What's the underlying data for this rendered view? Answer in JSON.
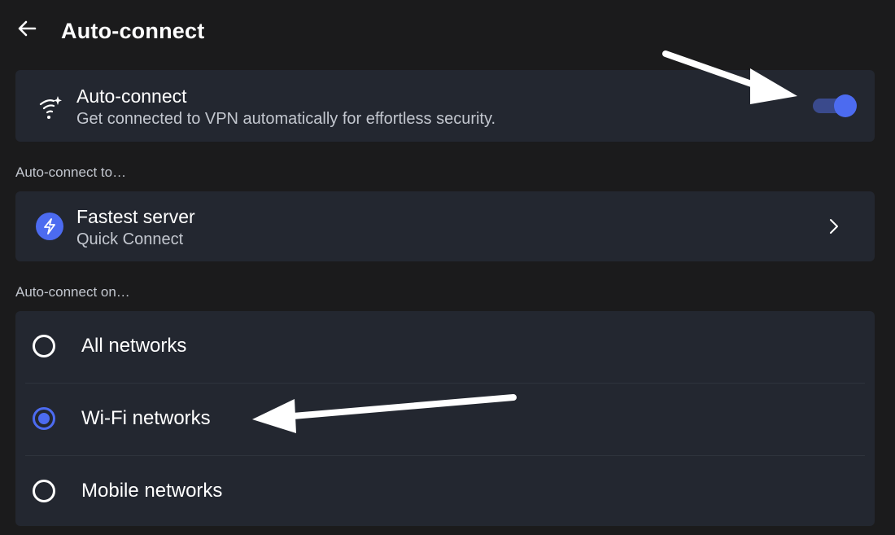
{
  "header": {
    "back_icon": "arrow-left-icon",
    "title": "Auto-connect"
  },
  "auto_connect": {
    "icon": "wifi-sparkle-icon",
    "title": "Auto-connect",
    "subtitle": "Get connected to VPN automatically for effortless security.",
    "enabled": true
  },
  "auto_connect_to": {
    "section_label": "Auto-connect to…",
    "icon": "bolt-icon",
    "title": "Fastest server",
    "subtitle": "Quick Connect",
    "chevron_icon": "chevron-right-icon"
  },
  "auto_connect_on": {
    "section_label": "Auto-connect on…",
    "options": [
      {
        "label": "All networks",
        "selected": false
      },
      {
        "label": "Wi-Fi networks",
        "selected": true
      },
      {
        "label": "Mobile networks",
        "selected": false
      }
    ]
  },
  "annotations": {
    "arrow_icon": "pointer-arrow-icon"
  },
  "colors": {
    "background": "#1b1b1c",
    "card": "#232730",
    "accent": "#4c6bf0",
    "toggle_track": "#3a4a8c",
    "muted_text": "#c3c7cf"
  }
}
